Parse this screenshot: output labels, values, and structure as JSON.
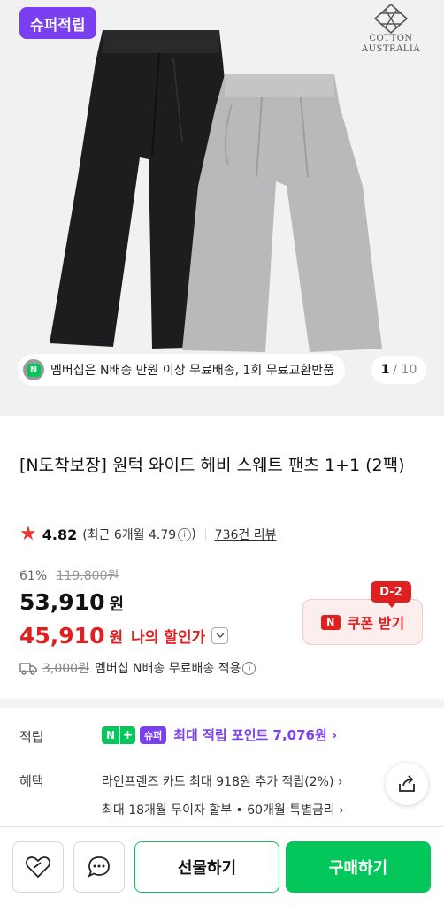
{
  "hero": {
    "super_badge": "슈퍼적립",
    "brand_logo_line1": "COTTON",
    "brand_logo_line2": "AUSTRALIA",
    "member_notice": "멤버십은 N배송 만원 이상 무료배송, 1회 무료교환반품",
    "member_icon_letter": "N",
    "page_current": "1",
    "page_total": "/ 10",
    "colors": {
      "super": "#7b3ff2",
      "naver_green": "#03c75a"
    }
  },
  "product": {
    "title": "[N도착보장] 원턱 와이드 헤비 스웨트 팬츠 1+1 (2팩)",
    "rating": "4.82",
    "rating_recent": "(최근 6개월 4.79",
    "rating_recent_close": ")",
    "info_icon": "i",
    "reviews": "736건 리뷰",
    "discount_rate": "61%",
    "original_price": "119,800원",
    "price": "53,910",
    "price_unit": "원",
    "my_price": "45,910",
    "my_price_unit": "원",
    "my_price_label": "나의 할인가",
    "coupon_icon": "N",
    "coupon_label": "쿠폰 받기",
    "coupon_dday": "D-2",
    "shipping_fee": "3,000원",
    "shipping_text": "멤버십 N배송 무료배송 적용"
  },
  "details": {
    "points_label": "적립",
    "nplus_n": "N",
    "nplus_plus": "+",
    "super_mini": "슈퍼",
    "points_text": "최대 적립 포인트 7,076원 ›",
    "benefit_label": "혜택",
    "benefit_1": "라인프렌즈 카드 최대 918원 추가 적립(2%) ›",
    "benefit_2": "최대 18개월 무이자 할부 • 60개월 특별금리 ›"
  },
  "bottom": {
    "gift_label": "선물하기",
    "buy_label": "구매하기"
  }
}
